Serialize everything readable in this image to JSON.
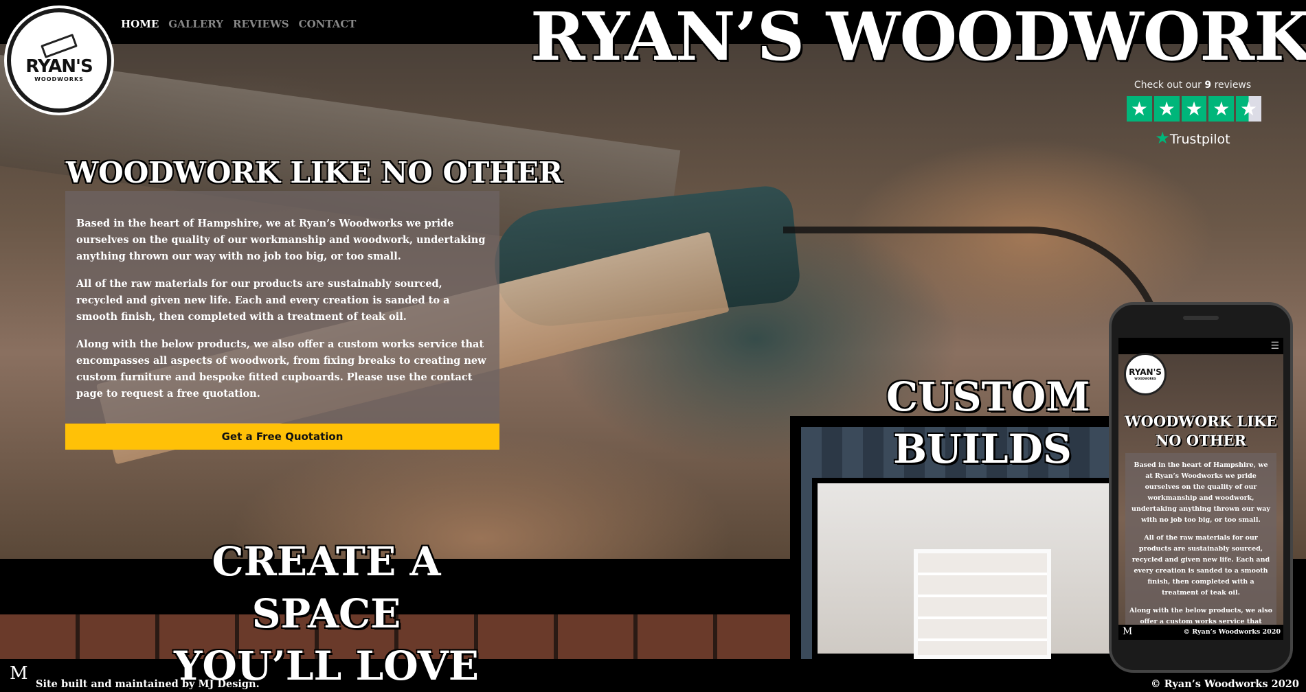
{
  "nav": {
    "items": [
      {
        "label": "HOME",
        "active": true
      },
      {
        "label": "GALLERY",
        "active": false
      },
      {
        "label": "REVIEWS",
        "active": false
      },
      {
        "label": "CONTACT",
        "active": false
      }
    ]
  },
  "logo": {
    "title": "RYAN'S",
    "subtitle": "WOODWORKS"
  },
  "site_title": "RYAN’S WOODWORKS",
  "trustpilot": {
    "prefix": "Check out our",
    "count": "9",
    "suffix": "reviews",
    "stars": 4.5,
    "brand": "Trustpilot",
    "color": "#00b67a"
  },
  "intro": {
    "title": "WOODWORK LIKE NO OTHER",
    "paragraphs": [
      "Based in the heart of Hampshire, we at Ryan’s Woodworks we pride ourselves on the quality of our workmanship and woodwork, undertaking anything thrown our way with no job too big, or too small.",
      "All of the raw materials for our products are sustainably sourced, recycled and given new life. Each and every creation is sanded to a smooth finish, then completed with a treatment of teak oil.",
      "Along with the below products, we also offer a custom works service that encompasses all aspects of woodwork, from fixing breaks to creating new custom furniture and bespoke fitted cupboards. Please use the contact page to request a free quotation."
    ],
    "cta": "Get a Free Quotation",
    "cta_color": "#ffc107"
  },
  "space": {
    "line1": "CREATE A SPACE",
    "line2": "YOU’LL LOVE"
  },
  "builds": {
    "line1": "CUSTOM",
    "line2": "BUILDS"
  },
  "phone": {
    "logo_title": "RYAN'S",
    "logo_subtitle": "WOODWORKS",
    "title": "WOODWORK LIKE NO OTHER",
    "paragraphs": [
      "Based in the heart of Hampshire, we at Ryan’s Woodworks we pride ourselves on the quality of our workmanship and woodwork, undertaking anything thrown our way with no job too big, or too small.",
      "All of the raw materials for our products are sustainably sourced, recycled and given new life. Each and every creation is sanded to a smooth finish, then completed with a treatment of teak oil.",
      "Along with the below products, we also offer a custom works service that"
    ],
    "footer": "© Ryan’s Woodworks 2020",
    "mark": "M"
  },
  "footer": {
    "mark": "M",
    "credit": "Site built and maintained by MJ Design.",
    "copyright": "© Ryan’s Woodworks 2020"
  }
}
